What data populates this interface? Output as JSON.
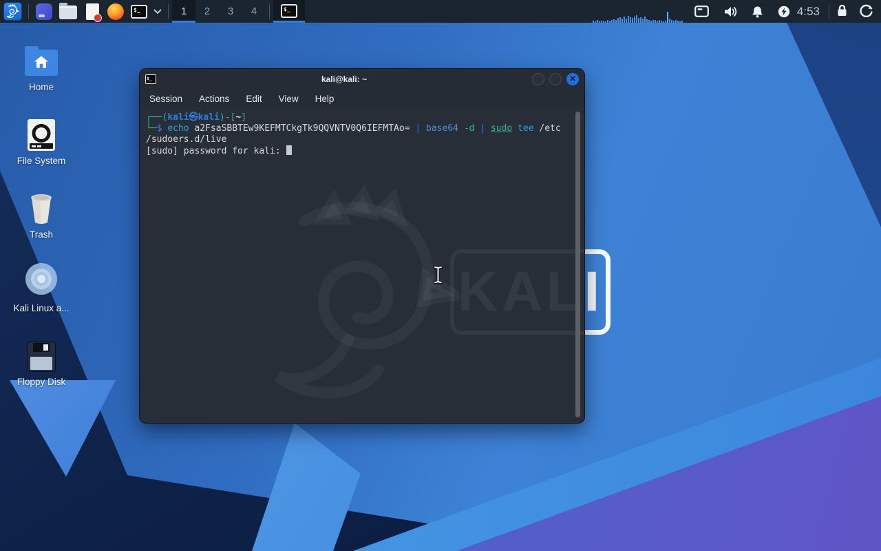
{
  "panel": {
    "clock": "4:53",
    "terminal_glyph": "$_",
    "workspaces": [
      {
        "label": "1",
        "active": true
      },
      {
        "label": "2",
        "active": false
      },
      {
        "label": "3",
        "active": false
      },
      {
        "label": "4",
        "active": false
      }
    ],
    "launcher_icons": [
      "kali-logo-icon",
      "app-window-icon",
      "file-manager-icon",
      "text-editor-icon",
      "firefox-icon",
      "terminal-icon",
      "chevron-down-icon"
    ],
    "tray_icons": [
      "display-icon",
      "volume-icon",
      "notifications-bell-icon",
      "power-manager-icon"
    ],
    "session_icons": [
      "lock-icon",
      "logout-icon"
    ],
    "cpu_bars": [
      3,
      2,
      4,
      2,
      3,
      3,
      2,
      4,
      3,
      4,
      5,
      4,
      7,
      8,
      6,
      9,
      6,
      10,
      8,
      7,
      9,
      11,
      7,
      8,
      6,
      9,
      5,
      4,
      3,
      4,
      4,
      3,
      4,
      3,
      2,
      3,
      16,
      6,
      4,
      3,
      4,
      3,
      2,
      3
    ]
  },
  "desktop": {
    "watermark_text": "KALI",
    "icons": [
      {
        "label": "Home"
      },
      {
        "label": "File System"
      },
      {
        "label": "Trash"
      },
      {
        "label": "Kali Linux a..."
      },
      {
        "label": "Floppy Disk"
      }
    ]
  },
  "terminal": {
    "title": "kali@kali: ~",
    "close_glyph": "✕",
    "watermark_text": "KALI",
    "menu": [
      "Session",
      "Actions",
      "Edit",
      "View",
      "Help"
    ],
    "colors": {
      "prompt": "#3fae96",
      "blue": "#2e7fdd",
      "fg": "#d7d9db",
      "cyan": "#2aa3dc",
      "pipe": "#2f6ce6",
      "cmdblue": "#4a8ed8",
      "teal": "#3fae96",
      "cursor": "#c6cad0"
    },
    "lines": [
      [
        {
          "t": "┌──(",
          "c": "prompt"
        },
        {
          "t": "kali㉿kali",
          "c": "blue",
          "b": true
        },
        {
          "t": ")-[",
          "c": "prompt"
        },
        {
          "t": "~",
          "c": "fg",
          "b": true
        },
        {
          "t": "]",
          "c": "prompt"
        }
      ],
      [
        {
          "t": "└─",
          "c": "prompt"
        },
        {
          "t": "$",
          "c": "blue"
        },
        {
          "t": " ",
          "c": "fg"
        },
        {
          "t": "echo",
          "c": "cyan"
        },
        {
          "t": " a2FsaSBBTEw9KEFMTCkgTk9QQVNTV0Q6IEFMTAo= ",
          "c": "fg"
        },
        {
          "t": "|",
          "c": "pipe"
        },
        {
          "t": " ",
          "c": "fg"
        },
        {
          "t": "base64",
          "c": "cmdblue"
        },
        {
          "t": " ",
          "c": "fg"
        },
        {
          "t": "-d",
          "c": "teal"
        },
        {
          "t": " ",
          "c": "fg"
        },
        {
          "t": "|",
          "c": "pipe"
        },
        {
          "t": " ",
          "c": "fg"
        },
        {
          "t": "sudo",
          "c": "teal",
          "u": true
        },
        {
          "t": " ",
          "c": "fg"
        },
        {
          "t": "tee",
          "c": "cyan"
        },
        {
          "t": " /etc",
          "c": "fg"
        }
      ],
      [
        {
          "t": "/sudoers.d/live",
          "c": "fg"
        }
      ],
      [
        {
          "t": "[sudo] password for kali: ",
          "c": "fg"
        },
        {
          "t": " ",
          "c": "fg",
          "cursor": true
        }
      ]
    ]
  }
}
